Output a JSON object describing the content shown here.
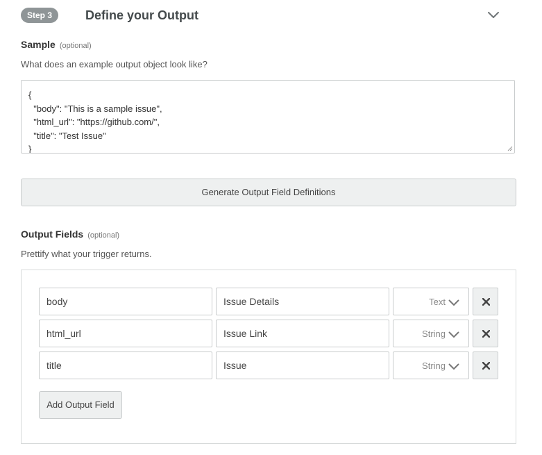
{
  "step": {
    "badge": "Step 3",
    "title": "Define your Output",
    "collapse_icon": "chevron-down-icon"
  },
  "sample": {
    "label": "Sample",
    "optional": "(optional)",
    "help": "What does an example output object look like?",
    "value": "{\n  \"body\": \"This is a sample issue\",\n  \"html_url\": \"https://github.com/\",\n  \"title\": \"Test Issue\"\n}"
  },
  "generate_button_label": "Generate Output Field Definitions",
  "output_fields": {
    "label": "Output Fields",
    "optional": "(optional)",
    "help": "Prettify what your trigger returns.",
    "rows": [
      {
        "key": "body",
        "label": "Issue Details",
        "type": "Text"
      },
      {
        "key": "html_url",
        "label": "Issue Link",
        "type": "String"
      },
      {
        "key": "title",
        "label": "Issue",
        "type": "String"
      }
    ],
    "add_button_label": "Add Output Field"
  },
  "colors": {
    "badge_bg": "#8f9597",
    "button_bg": "#eef0f0",
    "border": "#c9cccd"
  }
}
